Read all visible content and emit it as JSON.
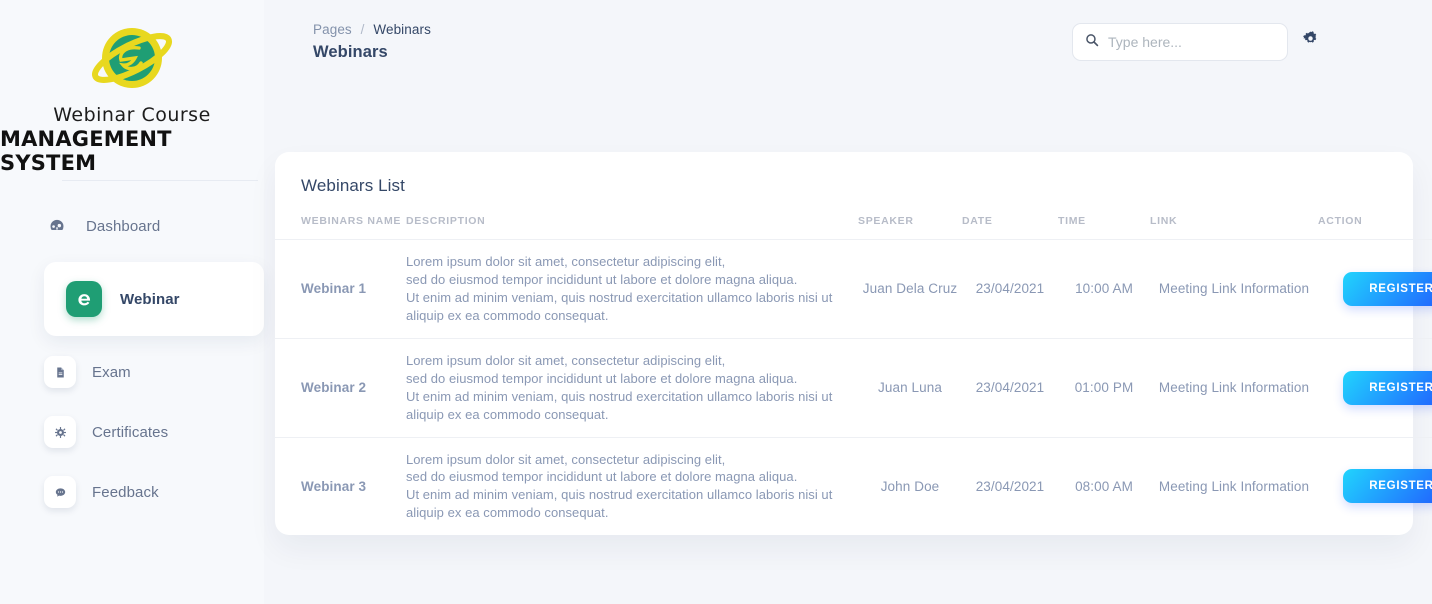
{
  "brand": {
    "line1": "Webinar Course",
    "line2": "MANAGEMENT SYSTEM",
    "logo_icon": "planet-icon",
    "colors": {
      "ring": "#e8d81f",
      "globe": "#1f9e74"
    }
  },
  "sidebar": {
    "items": [
      {
        "label": "Dashboard",
        "icon": "speedometer-icon",
        "active": false
      },
      {
        "label": "Webinar",
        "icon": "browser-e-icon",
        "active": true
      },
      {
        "label": "Exam",
        "icon": "document-icon",
        "active": false
      },
      {
        "label": "Certificates",
        "icon": "award-icon",
        "active": false
      },
      {
        "label": "Feedback",
        "icon": "chat-bubble-icon",
        "active": false
      }
    ]
  },
  "topbar": {
    "breadcrumb": {
      "parent": "Pages",
      "separator": "/",
      "current": "Webinars"
    },
    "page_title": "Webinars",
    "search": {
      "placeholder": "Type here...",
      "value": "",
      "icon": "search-icon"
    },
    "settings_icon": "gear-icon"
  },
  "main": {
    "card_title": "Webinars List",
    "table": {
      "headers": {
        "name": "WEBINARS NAME",
        "description": "DESCRIPTION",
        "speaker": "SPEAKER",
        "date": "DATE",
        "time": "TIME",
        "link": "LINK",
        "action": "ACTION"
      },
      "rows": [
        {
          "name": "Webinar 1",
          "description": "Lorem ipsum dolor sit amet, consectetur adipiscing elit,\nsed do eiusmod tempor incididunt ut labore et dolore magna aliqua.\nUt enim ad minim veniam, quis nostrud exercitation ullamco laboris nisi ut\naliquip ex ea commodo consequat.",
          "speaker": "Juan Dela Cruz",
          "date": "23/04/2021",
          "time": "10:00 AM",
          "link": "Meeting Link Information",
          "action": "REGISTER"
        },
        {
          "name": "Webinar 2",
          "description": "Lorem ipsum dolor sit amet, consectetur adipiscing elit,\nsed do eiusmod tempor incididunt ut labore et dolore magna aliqua.\nUt enim ad minim veniam, quis nostrud exercitation ullamco laboris nisi ut\naliquip ex ea commodo consequat.",
          "speaker": "Juan Luna",
          "date": "23/04/2021",
          "time": "01:00 PM",
          "link": "Meeting Link Information",
          "action": "REGISTER"
        },
        {
          "name": "Webinar 3",
          "description": "Lorem ipsum dolor sit amet, consectetur adipiscing elit,\nsed do eiusmod tempor incididunt ut labore et dolore magna aliqua.\nUt enim ad minim veniam, quis nostrud exercitation ullamco laboris nisi ut\naliquip ex ea commodo consequat.",
          "speaker": "John Doe",
          "date": "23/04/2021",
          "time": "08:00 AM",
          "link": "Meeting Link Information",
          "action": "REGISTER"
        }
      ]
    }
  },
  "theme": {
    "page_background": "#f4f6fa",
    "accent_blue_start": "#21d4fd",
    "accent_blue_end": "#2152ff",
    "accent_green": "#1f9e74",
    "text_dark": "#344767",
    "text_muted": "#8a98b4"
  }
}
